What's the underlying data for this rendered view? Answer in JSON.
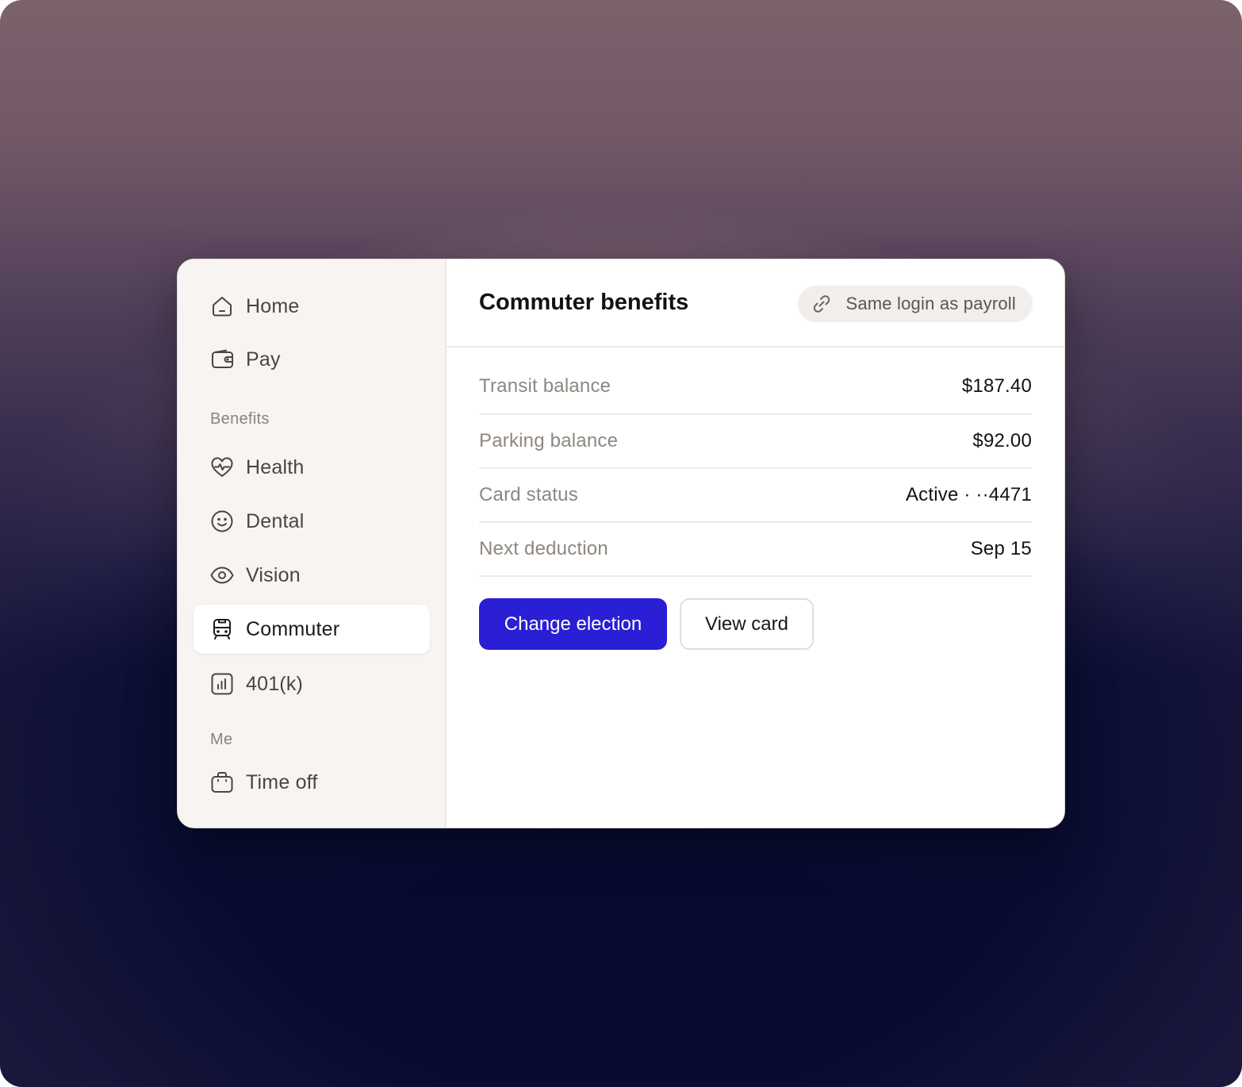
{
  "sidebar": {
    "items": [
      {
        "label": "Home",
        "icon": "home-icon"
      },
      {
        "label": "Pay",
        "icon": "wallet-icon"
      }
    ],
    "sections": [
      {
        "title": "Benefits",
        "items": [
          {
            "label": "Health",
            "icon": "heart-pulse-icon"
          },
          {
            "label": "Dental",
            "icon": "smile-icon"
          },
          {
            "label": "Vision",
            "icon": "eye-icon"
          },
          {
            "label": "Commuter",
            "icon": "train-icon",
            "active": true
          },
          {
            "label": "401(k)",
            "icon": "bar-chart-icon"
          }
        ]
      },
      {
        "title": "Me",
        "items": [
          {
            "label": "Time off",
            "icon": "briefcase-icon"
          }
        ]
      }
    ]
  },
  "main": {
    "title": "Commuter benefits",
    "login_pill": {
      "label": "Same login as payroll",
      "icon": "link-icon"
    },
    "rows": [
      {
        "label": "Transit balance",
        "value": "$187.40"
      },
      {
        "label": "Parking balance",
        "value": "$92.00"
      },
      {
        "label": "Card status",
        "value": "Active · ··4471"
      },
      {
        "label": "Next deduction",
        "value": "Sep 15"
      }
    ],
    "actions": {
      "primary": "Change election",
      "secondary": "View card"
    }
  },
  "colors": {
    "accent": "#2a1fd4",
    "sidebar_bg": "#f7f4f1",
    "text_primary": "#141210",
    "text_muted": "#8e8780"
  }
}
